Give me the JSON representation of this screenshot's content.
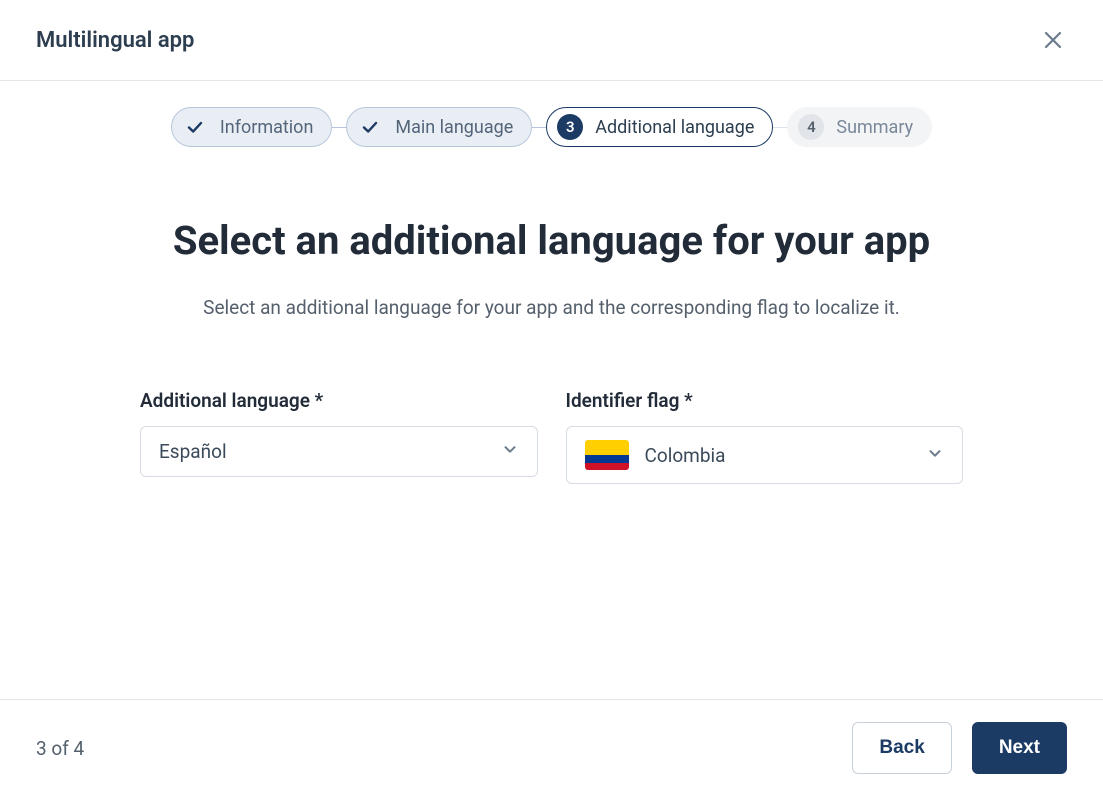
{
  "dialog": {
    "title": "Multilingual app"
  },
  "stepper": {
    "steps": [
      {
        "label": "Information"
      },
      {
        "label": "Main language"
      },
      {
        "label": "Additional language",
        "num": "3"
      },
      {
        "label": "Summary",
        "num": "4"
      }
    ]
  },
  "main": {
    "heading": "Select an additional language for your app",
    "subtext": "Select an additional language for your app and the corresponding flag to localize it."
  },
  "form": {
    "language_label": "Additional language *",
    "language_value": "Español",
    "flag_label": "Identifier flag *",
    "flag_value": "Colombia"
  },
  "footer": {
    "counter": "3 of 4",
    "back_label": "Back",
    "next_label": "Next"
  }
}
